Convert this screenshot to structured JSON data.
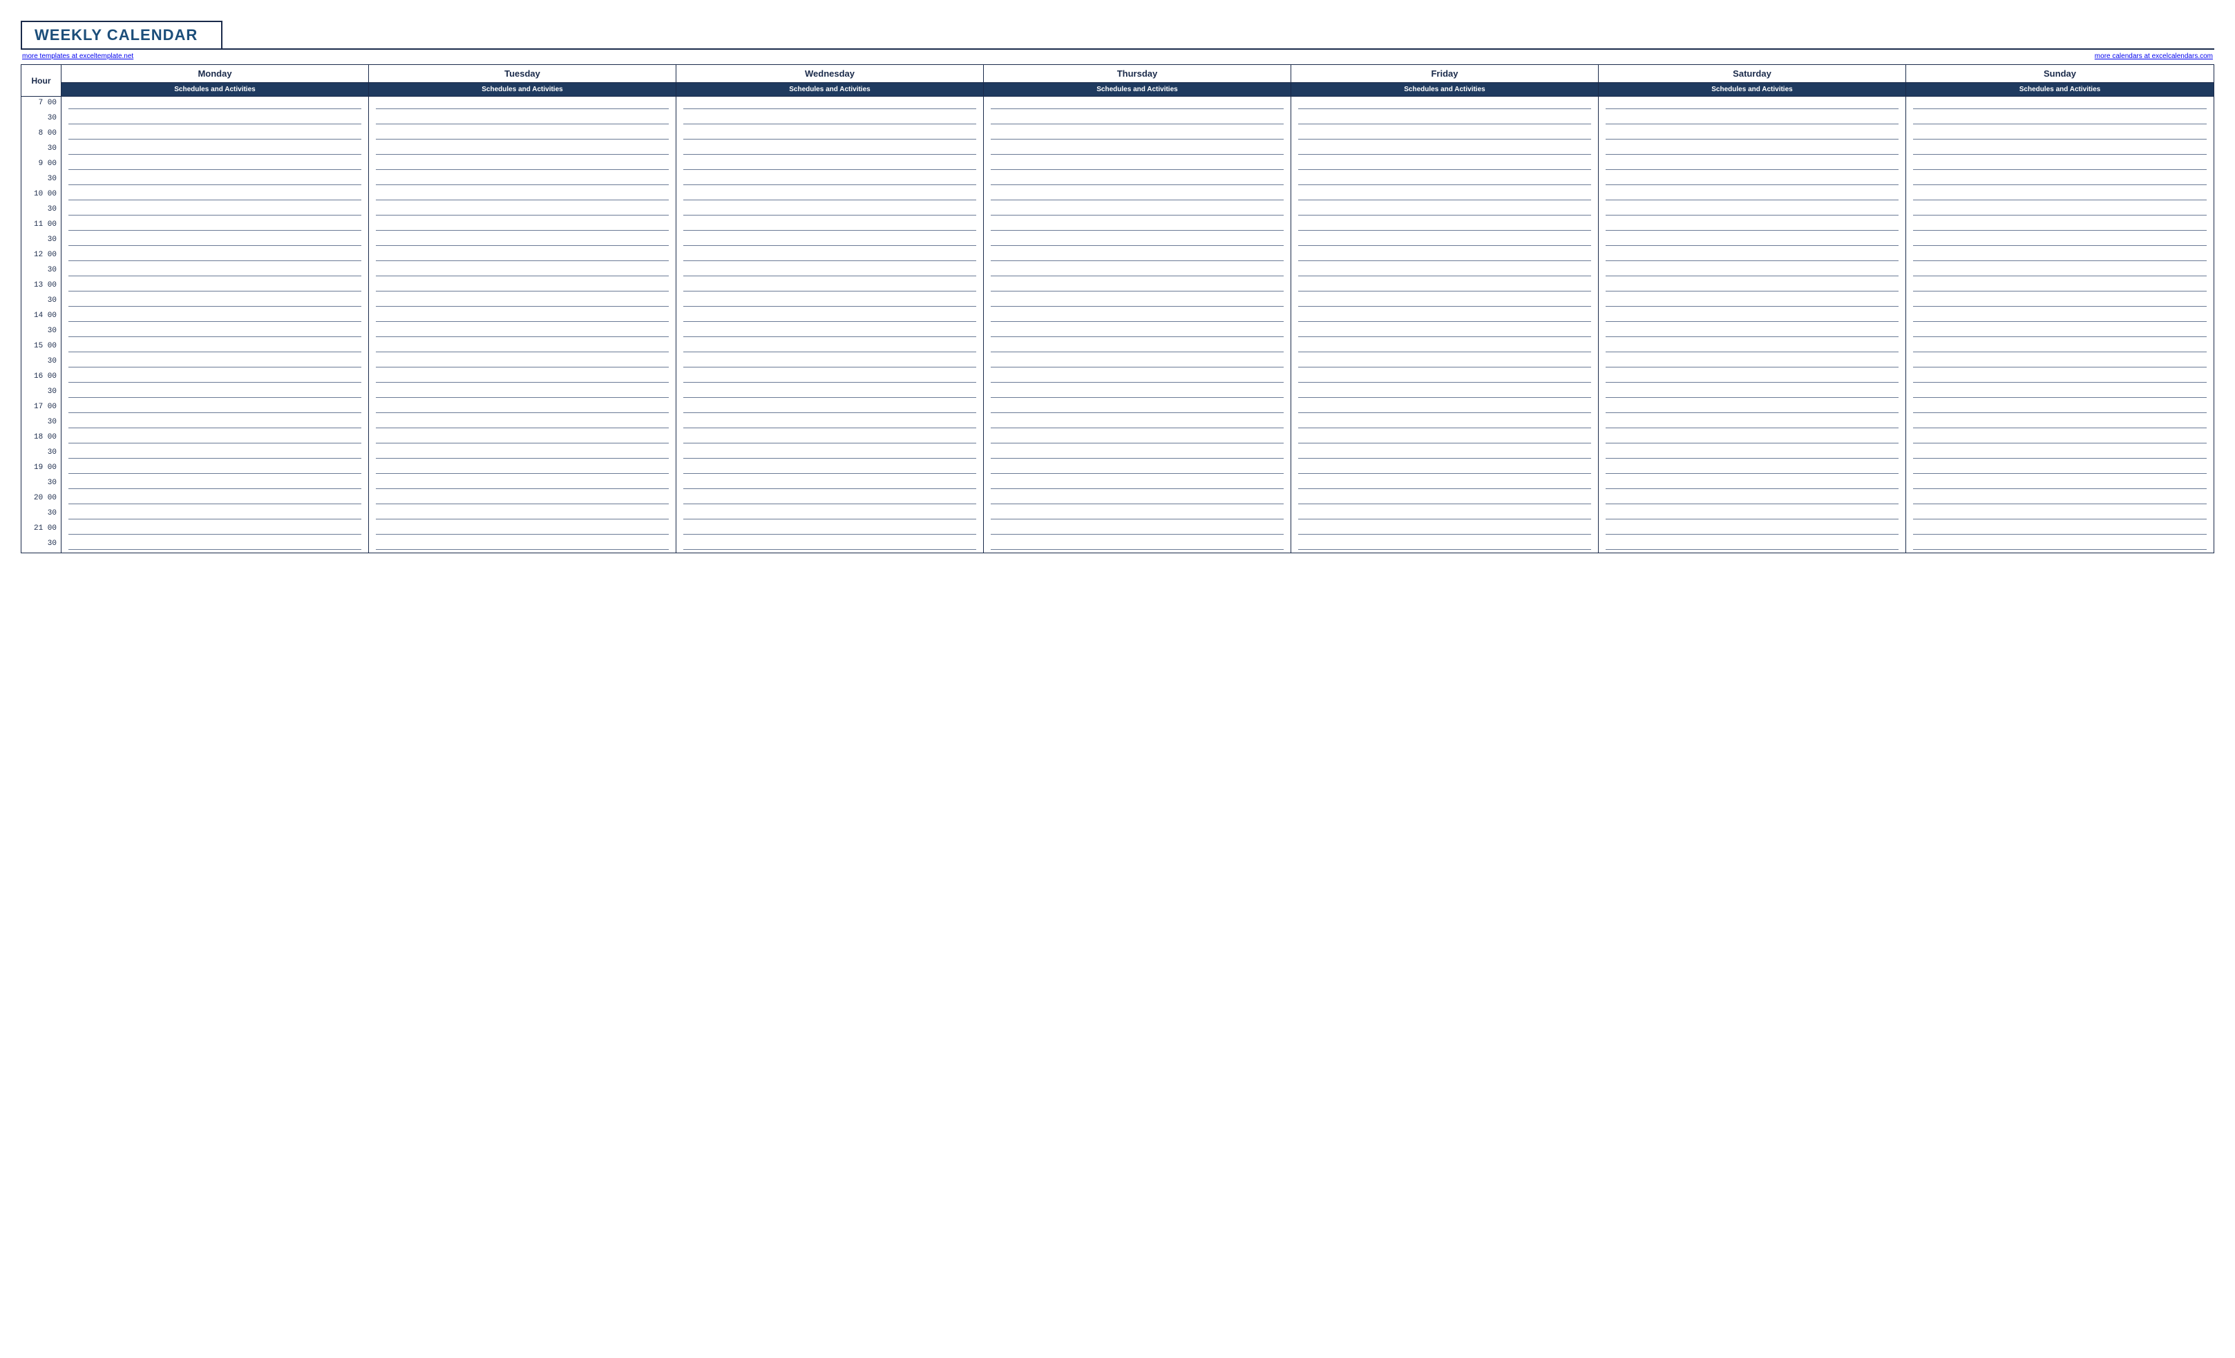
{
  "title": "WEEKLY CALENDAR",
  "link_left": "more templates at exceltemplate.net",
  "link_right": "more calendars at excelcalendars.com",
  "hour_label": "Hour",
  "days": [
    "Monday",
    "Tuesday",
    "Wednesday",
    "Thursday",
    "Friday",
    "Saturday",
    "Sunday"
  ],
  "subheader": "Schedules and Activities",
  "time_slots": [
    {
      "h": "7",
      "m": "00"
    },
    {
      "h": "",
      "m": "30"
    },
    {
      "h": "8",
      "m": "00"
    },
    {
      "h": "",
      "m": "30"
    },
    {
      "h": "9",
      "m": "00"
    },
    {
      "h": "",
      "m": "30"
    },
    {
      "h": "10",
      "m": "00"
    },
    {
      "h": "",
      "m": "30"
    },
    {
      "h": "11",
      "m": "00"
    },
    {
      "h": "",
      "m": "30"
    },
    {
      "h": "12",
      "m": "00"
    },
    {
      "h": "",
      "m": "30"
    },
    {
      "h": "13",
      "m": "00"
    },
    {
      "h": "",
      "m": "30"
    },
    {
      "h": "14",
      "m": "00"
    },
    {
      "h": "",
      "m": "30"
    },
    {
      "h": "15",
      "m": "00"
    },
    {
      "h": "",
      "m": "30"
    },
    {
      "h": "16",
      "m": "00"
    },
    {
      "h": "",
      "m": "30"
    },
    {
      "h": "17",
      "m": "00"
    },
    {
      "h": "",
      "m": "30"
    },
    {
      "h": "18",
      "m": "00"
    },
    {
      "h": "",
      "m": "30"
    },
    {
      "h": "19",
      "m": "00"
    },
    {
      "h": "",
      "m": "30"
    },
    {
      "h": "20",
      "m": "00"
    },
    {
      "h": "",
      "m": "30"
    },
    {
      "h": "21",
      "m": "00"
    },
    {
      "h": "",
      "m": "30"
    }
  ]
}
